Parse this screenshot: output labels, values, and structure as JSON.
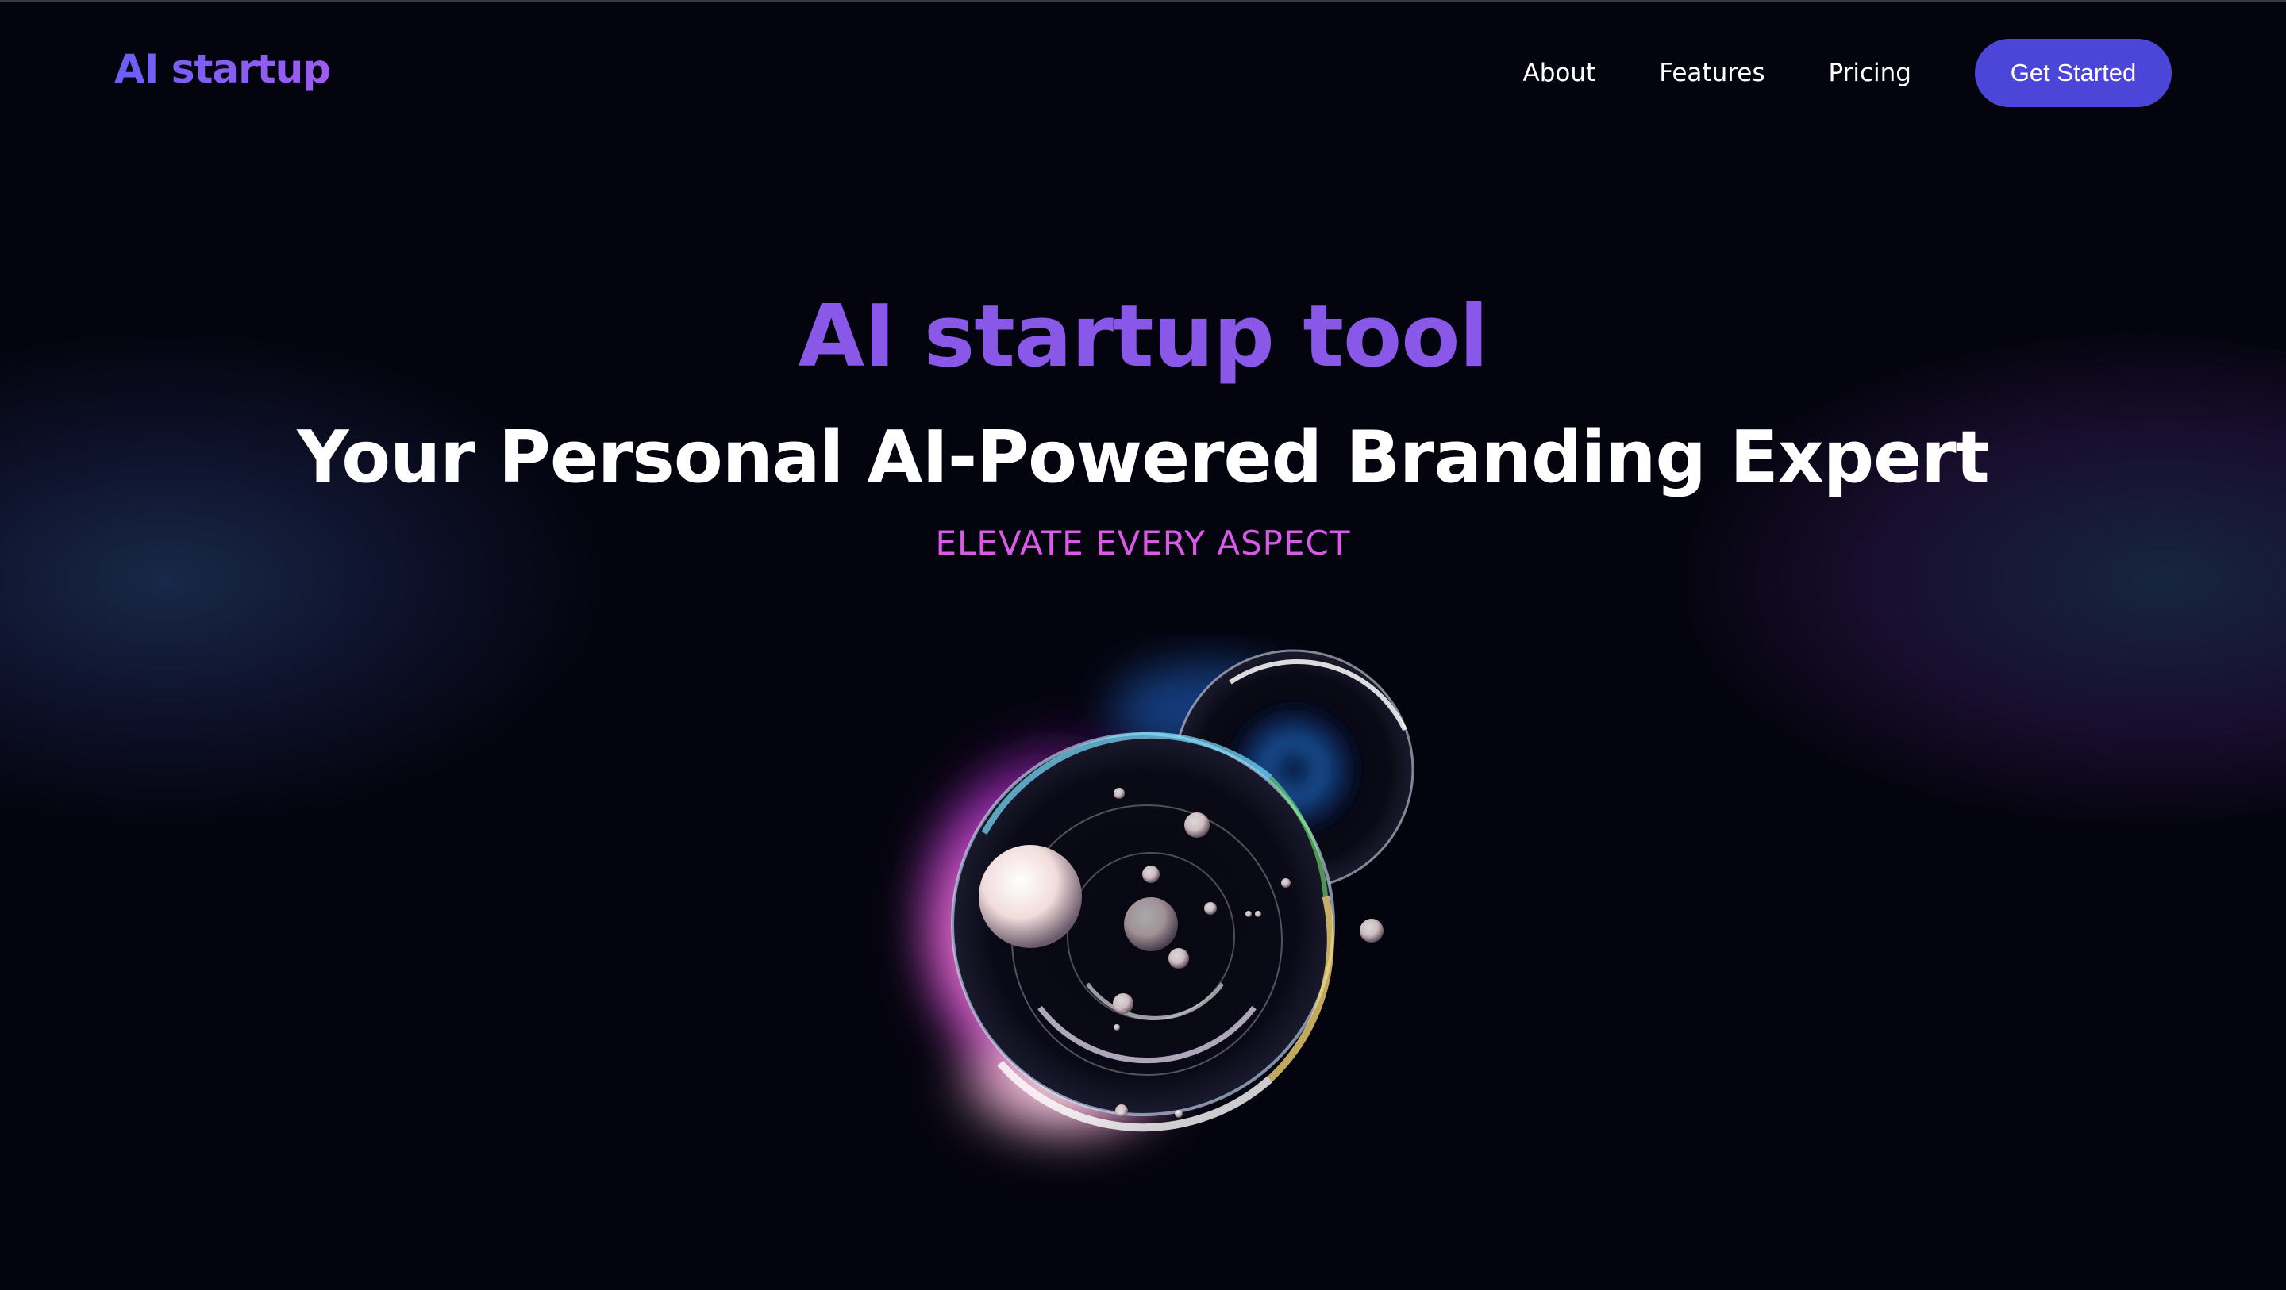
{
  "header": {
    "logo": "AI startup",
    "nav": {
      "about": "About",
      "features": "Features",
      "pricing": "Pricing"
    },
    "cta_label": "Get Started"
  },
  "hero": {
    "title": "AI startup tool",
    "subtitle": "Your Personal AI-Powered Branding Expert",
    "tagline": "ELEVATE EVERY ASPECT"
  },
  "colors": {
    "background": "#04040e",
    "accent_purple": "#8a58e8",
    "tagline_pink": "#d85ae6",
    "button": "#4b46d8"
  }
}
